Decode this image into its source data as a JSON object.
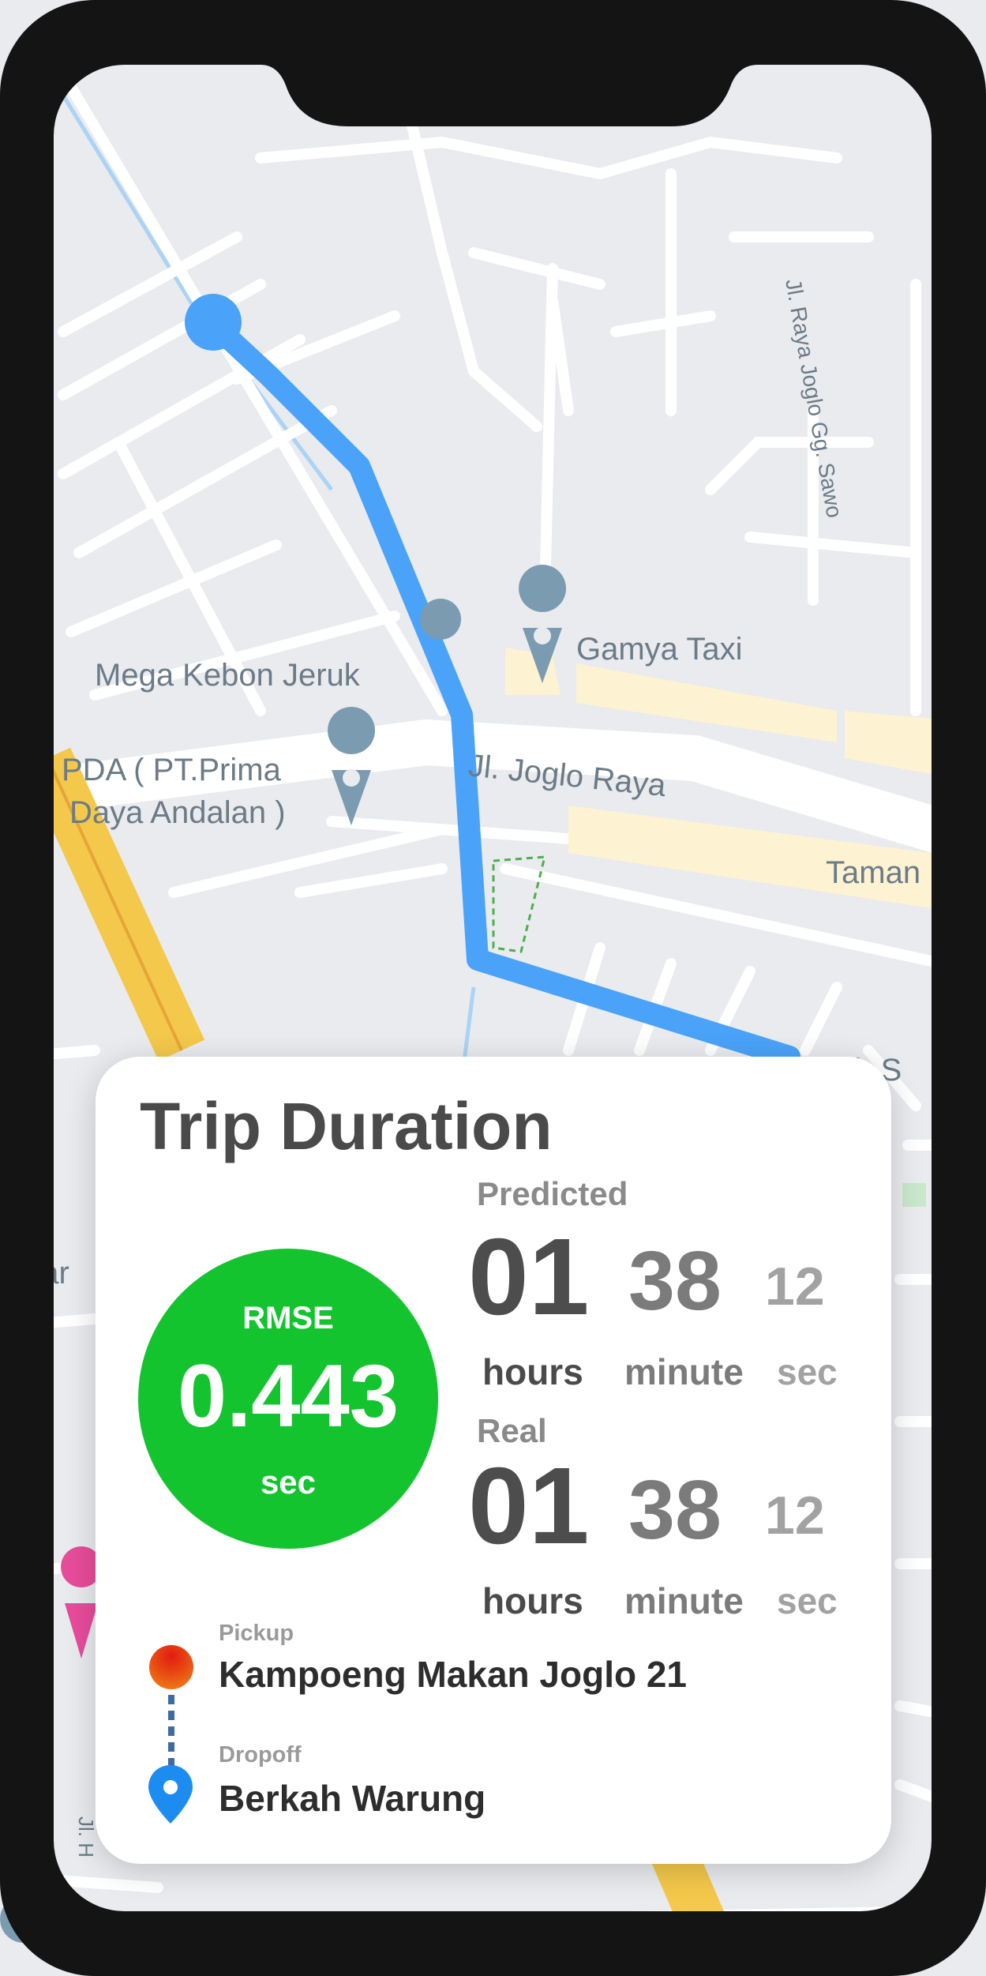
{
  "map": {
    "labels": {
      "gamya": "Gamya Taxi",
      "mega": "Mega Kebon Jeruk",
      "pda_line1": "PDA ( PT.Prima",
      "pda_line2": "Daya Andalan )",
      "joglo_raya": "Jl. Joglo Raya",
      "taman": "Taman",
      "sawo": "Jl. Raya Joglo Gg. Sawo",
      "ah_s": "ah S",
      "bar": "bar",
      "jl_h": "Jl. H"
    },
    "route_color": "#4aa3f8"
  },
  "card": {
    "title": "Trip Duration",
    "rmse": {
      "label": "RMSE",
      "value": "0.443",
      "unit": "sec",
      "color": "#13c42f"
    },
    "predicted": {
      "label": "Predicted",
      "hours": "01",
      "minutes": "38",
      "seconds": "12",
      "hours_unit": "hours",
      "minutes_unit": "minute",
      "seconds_unit": "sec"
    },
    "real": {
      "label": "Real",
      "hours": "01",
      "minutes": "38",
      "seconds": "12",
      "hours_unit": "hours",
      "minutes_unit": "minute",
      "seconds_unit": "sec"
    },
    "pickup": {
      "label": "Pickup",
      "name": "Kampoeng Makan Joglo 21"
    },
    "dropoff": {
      "label": "Dropoff",
      "name": "Berkah Warung"
    }
  }
}
